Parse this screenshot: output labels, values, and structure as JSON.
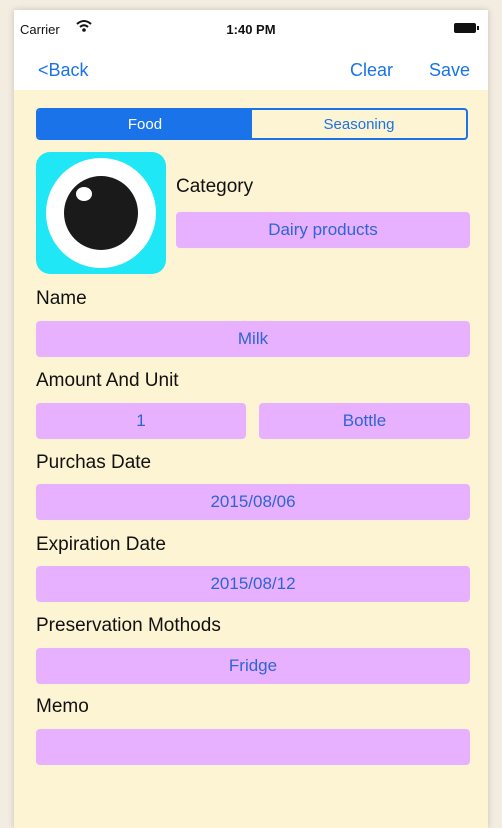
{
  "status": {
    "carrier": "Carrier",
    "time": "1:40 PM"
  },
  "nav": {
    "back": "<Back",
    "clear": "Clear",
    "save": "Save"
  },
  "segment": {
    "options": [
      "Food",
      "Seasoning"
    ],
    "selected": "Food"
  },
  "form": {
    "category": {
      "label": "Category",
      "value": "Dairy products"
    },
    "name": {
      "label": "Name",
      "value": "Milk"
    },
    "amount": {
      "label": "Amount And Unit",
      "amount": "1",
      "unit": "Bottle"
    },
    "purchase": {
      "label": "Purchas Date",
      "value": "2015/08/06"
    },
    "expiration": {
      "label": "Expiration Date",
      "value": "2015/08/12"
    },
    "preservation": {
      "label": "Preservation Mothods",
      "value": "Fridge"
    },
    "memo": {
      "label": "Memo",
      "value": ""
    }
  },
  "colors": {
    "accent": "#1a73e8",
    "background": "#fdf4d3",
    "field": "#e8b1ff",
    "photo_bg": "#1fe7f6"
  },
  "icons": {
    "photo": "eye-icon",
    "wifi": "wifi-icon",
    "battery": "battery-icon"
  }
}
